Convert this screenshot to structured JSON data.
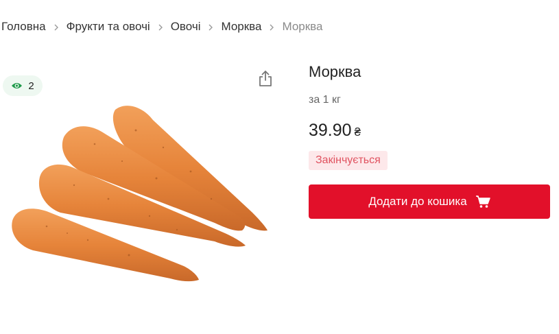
{
  "breadcrumb": {
    "items": [
      "Головна",
      "Фрукти та овочі",
      "Овочі",
      "Морква"
    ],
    "current": "Морква"
  },
  "views": {
    "count": "2",
    "icon": "eye-icon"
  },
  "share": {
    "icon": "share-icon"
  },
  "product": {
    "title": "Морква",
    "unit": "за 1 кг",
    "price": "39.90",
    "currency": "₴",
    "stock_status": "Закінчується",
    "add_to_cart_label": "Додати до кошика",
    "cart_icon": "cart-icon",
    "accent_color": "#e2102a"
  }
}
